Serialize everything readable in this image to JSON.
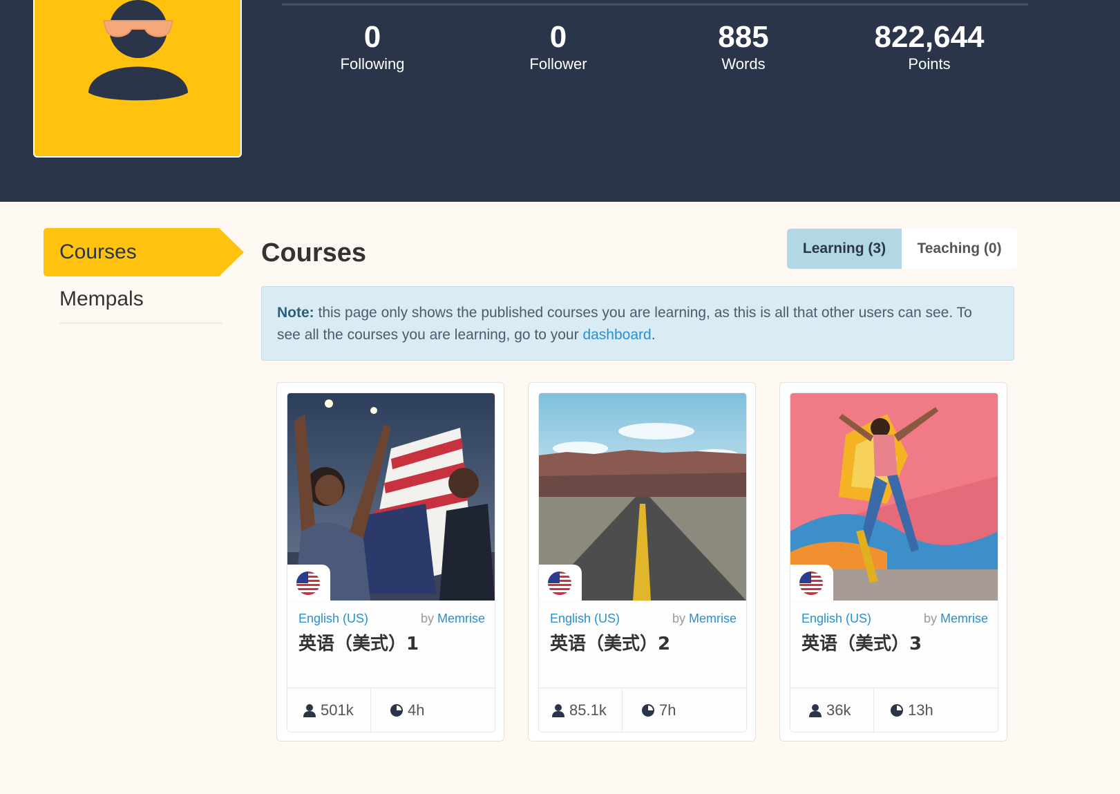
{
  "profile": {
    "stats": [
      {
        "value": "0",
        "label": "Following"
      },
      {
        "value": "0",
        "label": "Follower"
      },
      {
        "value": "885",
        "label": "Words"
      },
      {
        "value": "822,644",
        "label": "Points"
      }
    ]
  },
  "sidebar": {
    "items": [
      {
        "label": "Courses",
        "active": true
      },
      {
        "label": "Mempals",
        "active": false
      }
    ],
    "active_color": "#ffc20e"
  },
  "main": {
    "title": "Courses",
    "tabs": [
      {
        "label": "Learning (3)",
        "selected": true
      },
      {
        "label": "Teaching (0)",
        "selected": false
      }
    ],
    "note": {
      "prefix": "Note:",
      "text": " this page only shows the published courses you are learning, as this is all that other users can see. To see all the courses you are learning, go to your ",
      "link": "dashboard",
      "suffix": "."
    },
    "courses": [
      {
        "language": "English (US)",
        "by": "by",
        "author": "Memrise",
        "title": "英语（美式）1",
        "learners": "501k",
        "time": "4h",
        "flag_icon": "us-flag-icon"
      },
      {
        "language": "English (US)",
        "by": "by",
        "author": "Memrise",
        "title": "英语（美式）2",
        "learners": "85.1k",
        "time": "7h",
        "flag_icon": "us-flag-icon"
      },
      {
        "language": "English (US)",
        "by": "by",
        "author": "Memrise",
        "title": "英语（美式）3",
        "learners": "36k",
        "time": "13h",
        "flag_icon": "us-flag-icon"
      }
    ]
  },
  "colors": {
    "header_bg": "#2b3549",
    "accent_yellow": "#ffc20e",
    "link_blue": "#2a8fd0",
    "page_bg": "#fdf9f2"
  }
}
